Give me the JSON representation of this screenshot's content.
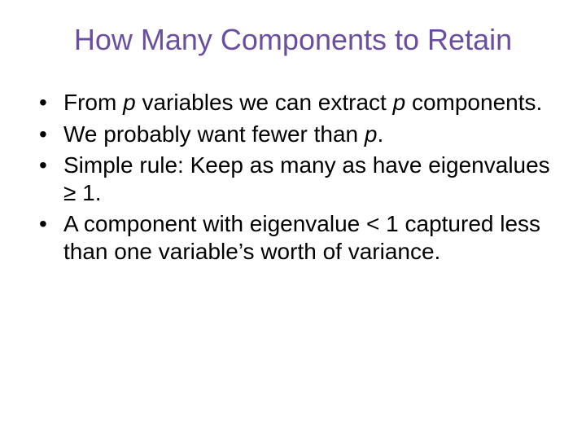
{
  "title": "How Many Components to Retain",
  "bullets": {
    "b1": {
      "t1": "From ",
      "p1": "p",
      "t2": " variables we can extract ",
      "p2": "p",
      "t3": " components."
    },
    "b2": {
      "t1": "We probably want fewer than ",
      "p1": "p",
      "t2": "."
    },
    "b3": {
      "t1": "Simple rule:  Keep as many as have eigenvalues ",
      "sym": "≥",
      "t2": " 1."
    },
    "b4": {
      "t1": "A component with eigenvalue < 1 captured less than one variable’s worth of variance."
    }
  }
}
